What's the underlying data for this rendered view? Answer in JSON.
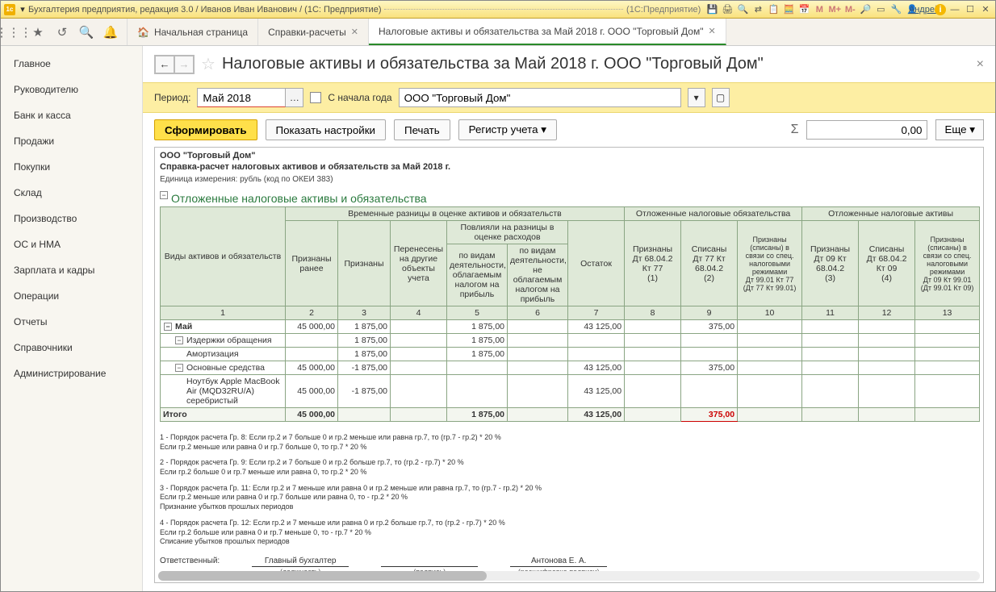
{
  "titlebar": {
    "app_title": "Бухгалтерия предприятия, редакция 3.0 / Иванов Иван Иванович / (1С: Предприятие)",
    "app_suffix": "(1С:Предприятие)",
    "user_label": "Андрей",
    "m_labels": [
      "M",
      "M+",
      "M-"
    ]
  },
  "tabs": {
    "home": "Начальная страница",
    "tab1": "Справки-расчеты",
    "tab2": "Налоговые активы и обязательства за Май 2018 г. ООО \"Торговый Дом\""
  },
  "sidebar": {
    "items": [
      "Главное",
      "Руководителю",
      "Банк и касса",
      "Продажи",
      "Покупки",
      "Склад",
      "Производство",
      "ОС и НМА",
      "Зарплата и кадры",
      "Операции",
      "Отчеты",
      "Справочники",
      "Администрирование"
    ]
  },
  "page": {
    "title": "Налоговые активы и обязательства за Май 2018 г. ООО \"Торговый Дом\""
  },
  "params": {
    "period_label": "Период:",
    "period_value": "Май 2018",
    "since_year": "С начала года",
    "org_value": "ООО \"Торговый Дом\""
  },
  "actions": {
    "form": "Сформировать",
    "show_settings": "Показать настройки",
    "print": "Печать",
    "register": "Регистр учета",
    "sum_value": "0,00",
    "more": "Еще"
  },
  "report": {
    "org": "ООО \"Торговый Дом\"",
    "title": "Справка-расчет налоговых активов и обязательств за Май 2018 г.",
    "unit": "Единица измерения: рубль (код по ОКЕИ 383)",
    "section": "Отложенные налоговые активы и обязательства",
    "headers": {
      "h_kinds": "Виды активов и обязательств",
      "h_temp": "Временные разницы в оценке активов и обязательств",
      "h_ono": "Отложенные налоговые обязательства",
      "h_ona": "Отложенные налоговые активы",
      "h_prev": "Признаны ранее",
      "h_recog": "Признаны",
      "h_moved": "Перенесены на другие объекты учета",
      "h_affect": "Повлияли на разницы в оценке расходов",
      "h_tax": "по видам деятельности, облагаемым налогом на прибыль",
      "h_notax": "по видам деятельности, не облагаемым налогом на прибыль",
      "h_balance": "Остаток",
      "h_c8": "Признаны\nДт 68.04.2\nКт 77\n(1)",
      "h_c9": "Списаны\nДт 77 Кт\n68.04.2\n(2)",
      "h_c10": "Признаны (списаны) в связи со спец. налоговыми режимами\nДт 99.01 Кт 77\n(Дт 77 Кт 99.01)",
      "h_c11": "Признаны\nДт 09 Кт\n68.04.2\n(3)",
      "h_c12": "Списаны\nДт 68.04.2\nКт 09\n(4)",
      "h_c13": "Признаны (списаны) в связи со спец. налоговыми режимами\nДт 09 Кт 99.01\n(Дт 99.01 Кт 09)"
    },
    "colnums": [
      "1",
      "2",
      "3",
      "4",
      "5",
      "6",
      "7",
      "8",
      "9",
      "10",
      "11",
      "12",
      "13"
    ],
    "rows": [
      {
        "lvl": 0,
        "label": "Май",
        "c2": "45 000,00",
        "c3": "1 875,00",
        "c5": "1 875,00",
        "c7": "43 125,00",
        "c9": "375,00"
      },
      {
        "lvl": 1,
        "label": "Издержки обращения",
        "c3": "1 875,00",
        "c5": "1 875,00"
      },
      {
        "lvl": 2,
        "label": "Амортизация",
        "c3": "1 875,00",
        "c5": "1 875,00"
      },
      {
        "lvl": 1,
        "label": "Основные средства",
        "c2": "45 000,00",
        "c3": "-1 875,00",
        "c7": "43 125,00",
        "c9": "375,00"
      },
      {
        "lvl": 2,
        "label": "Ноутбук Apple MacBook Air (MQD32RU/A) серебристый",
        "c2": "45 000,00",
        "c3": "-1 875,00",
        "c7": "43 125,00"
      }
    ],
    "total": {
      "label": "Итого",
      "c2": "45 000,00",
      "c5": "1 875,00",
      "c7": "43 125,00",
      "c9": "375,00"
    },
    "notes": [
      "1 - Порядок расчета Гр. 8: Если гр.2 и 7 больше 0 и гр.2 меньше или равна гр.7, то (гр.7 - гр.2) * 20 %\nЕсли гр.2 меньше или равна 0 и гр.7 больше 0, то  гр.7 * 20 %",
      "2 - Порядок расчета Гр. 9: Если гр.2 и 7 больше 0 и гр.2 больше гр.7, то (гр.2 - гр.7) * 20 %\nЕсли гр.2 больше 0 и гр.7 меньше или равна 0, то  гр.2 * 20 %",
      "3 - Порядок расчета Гр. 11:  Если гр.2 и 7 меньше или равна 0 и гр.2 меньше или равна гр.7, то (гр.7 - гр.2) * 20 %\nЕсли гр.2 меньше или равна 0 и гр.7 больше или равна 0, то - гр.2 * 20 %\nПризнание убытков прошлых периодов",
      "4 - Порядок расчета Гр. 12:  Если гр.2 и 7 меньше или равна 0 и гр.2 больше гр.7, то (гр.2 - гр.7) * 20 %\nЕсли гр.2 больше или равна 0 и гр.7 меньше 0, то - гр.7 * 20 %\nСписание убытков прошлых периодов"
    ],
    "sign": {
      "resp": "Ответственный:",
      "position_val": "Главный бухгалтер",
      "position_lbl": "(должность)",
      "sign_lbl": "(подпись)",
      "name_val": "Антонова Е. А.",
      "name_lbl": "(расшифровка подписи)"
    }
  }
}
